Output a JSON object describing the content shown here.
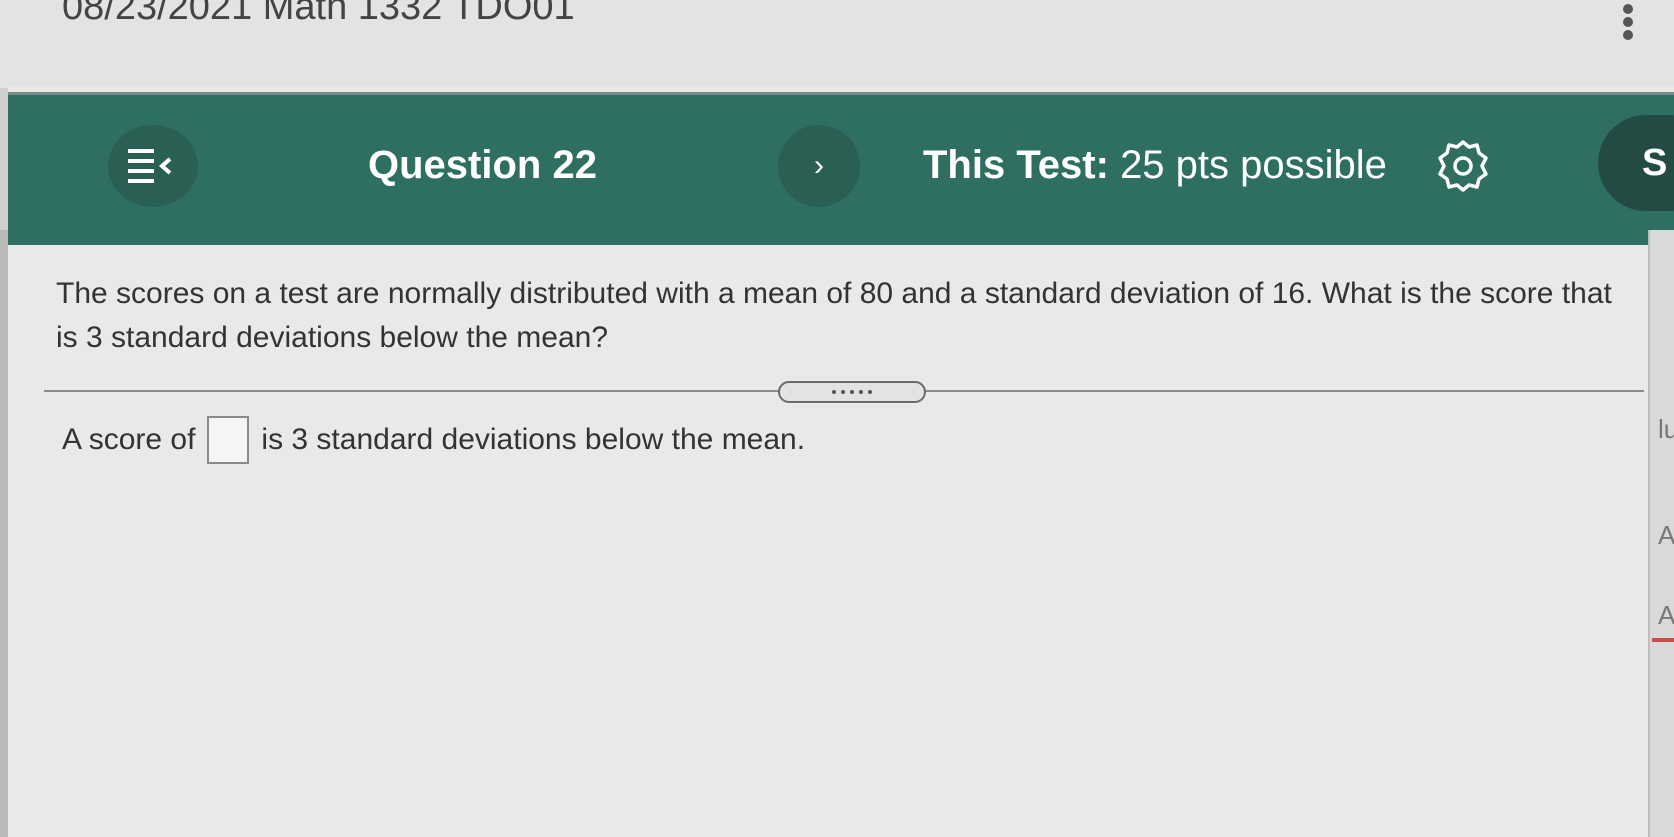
{
  "window": {
    "title": "08/23/2021 Math 1332 TDO01"
  },
  "toolbar": {
    "question_label": "Question 22",
    "next_symbol": "›",
    "test_prefix": "This Test:",
    "test_points": "25 pts possible",
    "save_partial": "S",
    "icons": {
      "menu": "menu-collapse-icon",
      "next": "chevron-right-icon",
      "settings": "gear-icon"
    },
    "colors": {
      "bar": "#2f6f62",
      "button": "#2a5f54",
      "save": "#234b43"
    }
  },
  "question": {
    "text": "The scores on a test are normally distributed with a mean of 80 and a standard deviation of 16. What is the score that is 3 standard deviations below the mean?"
  },
  "answer": {
    "prefix": "A score of",
    "value": "",
    "suffix": "is 3 standard deviations below the mean."
  },
  "right_panel": {
    "glyphs": [
      "lu",
      "A",
      "A"
    ]
  }
}
